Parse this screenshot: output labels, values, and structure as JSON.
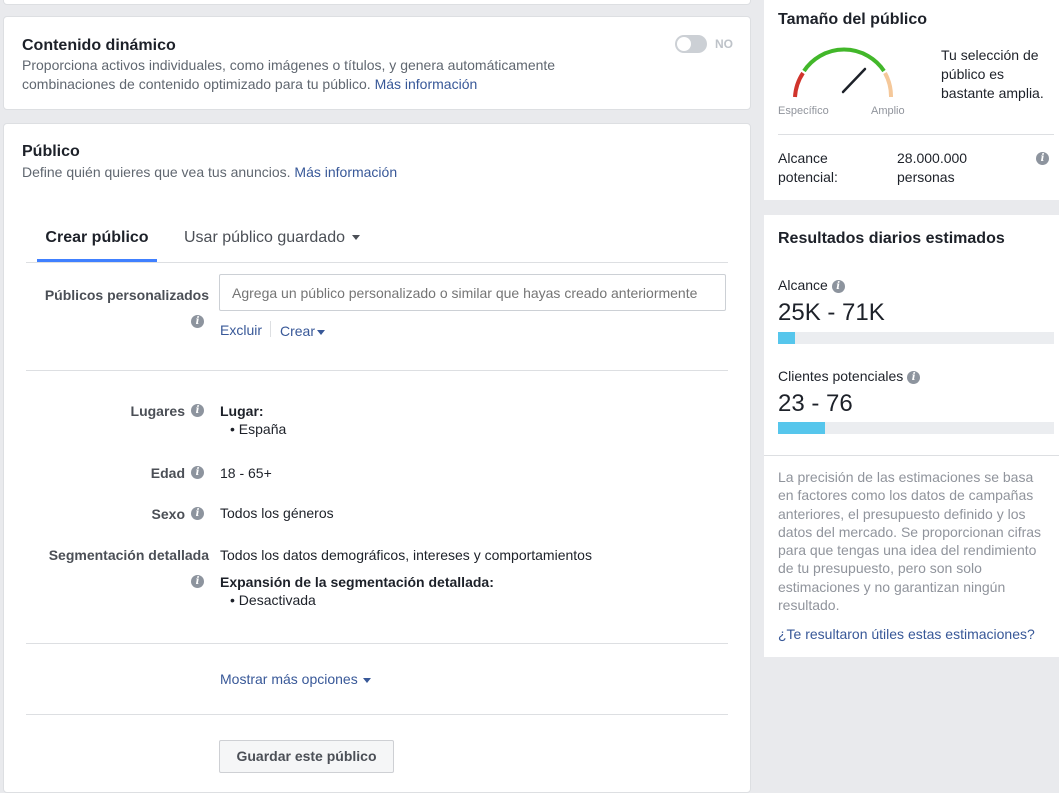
{
  "dynamic": {
    "title": "Contenido dinámico",
    "desc1": "Proporciona activos individuales, como imágenes o títulos, y genera automáticamente",
    "desc2": "combinaciones de contenido optimizado para tu público.",
    "link": "Más información",
    "toggle_label": "NO",
    "toggle_on": false
  },
  "audience": {
    "title": "Público",
    "desc": "Define quién quieres que vea tus anuncios.",
    "link": "Más información",
    "tabs": [
      {
        "label": "Crear público",
        "active": true
      },
      {
        "label": "Usar público guardado",
        "active": false
      }
    ],
    "custom": {
      "label": "Públicos personalizados",
      "placeholder": "Agrega un público personalizado o similar que hayas creado anteriormente",
      "exclude": "Excluir",
      "create": "Crear"
    },
    "places": {
      "label": "Lugares",
      "heading": "Lugar:",
      "item": "España"
    },
    "age": {
      "label": "Edad",
      "value": "18 - 65+"
    },
    "gender": {
      "label": "Sexo",
      "value": "Todos los géneros"
    },
    "detailed": {
      "label": "Segmentación detallada",
      "value": "Todos los datos demográficos, intereses y comportamientos",
      "expansion_heading": "Expansión de la segmentación detallada:",
      "expansion_item": "Desactivada"
    },
    "more_options": "Mostrar más opciones",
    "save_button": "Guardar este público"
  },
  "size": {
    "title": "Tamaño del público",
    "gauge_left": "Específico",
    "gauge_right": "Amplio",
    "desc_lines": [
      "Tu selección de",
      "público es",
      "bastante amplia."
    ],
    "reach_label_lines": [
      "Alcance",
      "potencial:"
    ],
    "reach_value_lines": [
      "28.000.000",
      "personas"
    ]
  },
  "daily": {
    "title": "Resultados diarios estimados",
    "reach_label": "Alcance",
    "reach_value": "25K - 71K",
    "reach_fraction": 0.06,
    "leads_label": "Clientes potenciales",
    "leads_value": "23 - 76",
    "leads_fraction": 0.17,
    "disclaimer_lines": [
      "La precisión de las estimaciones se basa",
      "en factores como los datos de campañas",
      "anteriores, el presupuesto definido y los",
      "datos del mercado. Se proporcionan cifras",
      "para que tengas una idea del rendimiento",
      "de tu presupuesto, pero son solo",
      "estimaciones y no garantizan ningún",
      "resultado."
    ],
    "feedback": "¿Te resultaron útiles estas estimaciones?"
  },
  "colors": {
    "accent": "#4080ff",
    "link": "#385898",
    "bar_fill": "#56c6ec",
    "gauge_green": "#42b72a",
    "gauge_red": "#d0342c",
    "gauge_orange": "#f5c89a"
  }
}
